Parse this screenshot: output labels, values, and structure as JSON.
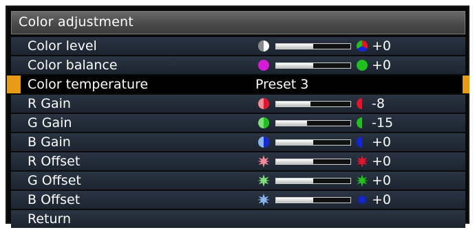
{
  "menu": {
    "title": "Color adjustment",
    "rows": [
      {
        "key": "color_level",
        "label": "Color level",
        "type": "slider",
        "value": "+0",
        "level": 0.5,
        "left_icon": "contrast-gray-icon",
        "right_icon": "rgb-wheel-icon"
      },
      {
        "key": "color_balance",
        "label": "Color balance",
        "type": "slider",
        "value": "+0",
        "level": 0.5,
        "left_icon": "magenta-dot-icon",
        "right_icon": "green-dot-icon"
      },
      {
        "key": "color_temperature",
        "label": "Color temperature",
        "type": "text",
        "value": "Preset 3",
        "selected": true
      },
      {
        "key": "r_gain",
        "label": "R Gain",
        "type": "slider",
        "value": "-8",
        "level": 0.46,
        "left_icon": "red-half-circle-icon",
        "right_icon": "red-half-circle-icon"
      },
      {
        "key": "g_gain",
        "label": "G Gain",
        "type": "slider",
        "value": "-15",
        "level": 0.42,
        "left_icon": "green-half-circle-icon",
        "right_icon": "green-half-circle-icon"
      },
      {
        "key": "b_gain",
        "label": "B Gain",
        "type": "slider",
        "value": "+0",
        "level": 0.5,
        "left_icon": "blue-half-circle-icon",
        "right_icon": "blue-half-circle-icon"
      },
      {
        "key": "r_offset",
        "label": "R Offset",
        "type": "slider",
        "value": "+0",
        "level": 0.5,
        "left_icon": "pink-star-icon",
        "right_icon": "red-star-icon"
      },
      {
        "key": "g_offset",
        "label": "G Offset",
        "type": "slider",
        "value": "+0",
        "level": 0.5,
        "left_icon": "light-green-star-icon",
        "right_icon": "green-star-icon"
      },
      {
        "key": "b_offset",
        "label": "B Offset",
        "type": "slider",
        "value": "+0",
        "level": 0.5,
        "left_icon": "light-blue-star-icon",
        "right_icon": "blue-star-icon"
      },
      {
        "key": "return",
        "label": "Return",
        "type": "none"
      }
    ]
  },
  "colors": {
    "accent": "#e89b14",
    "row_bg": "#2a3442",
    "red": "#e8132b",
    "red_light": "#f58a97",
    "green": "#1fc21c",
    "green_light": "#7ee07a",
    "blue": "#1226e0",
    "blue_light": "#8ab4f0",
    "magenta": "#d61ad6"
  }
}
